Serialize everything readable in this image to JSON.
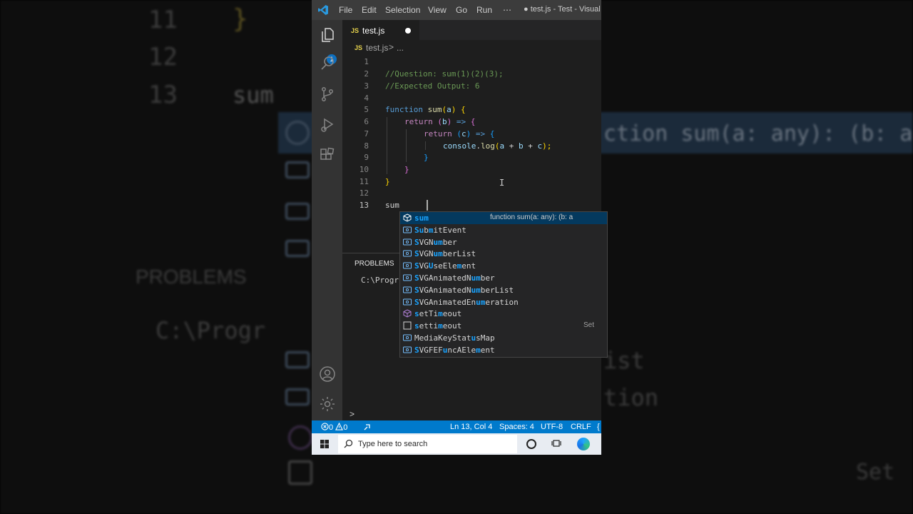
{
  "background_mirror": {
    "line_numbers": [
      "11",
      "12",
      "13"
    ],
    "brace": "}",
    "typed": "sum",
    "signature": "ction sum(a: any): (b: a",
    "panel_label": "PROBLEMS",
    "terminal": "C:\\Progr",
    "fragment_1": "ist",
    "fragment_2": "tion",
    "fragment_3": "Set"
  },
  "titlebar": {
    "menu": [
      "File",
      "Edit",
      "Selection",
      "View",
      "Go",
      "Run",
      "⋯"
    ],
    "window_title": "● test.js - Test - Visual S"
  },
  "activity_bar": {
    "explorer_badge": "1",
    "icons": [
      "files-icon",
      "search-icon",
      "source-control-icon",
      "run-debug-icon",
      "extensions-icon",
      "account-icon",
      "settings-gear-icon"
    ]
  },
  "tab": {
    "icon": "JS",
    "label": "test.js"
  },
  "breadcrumb": {
    "icon": "JS",
    "file": "test.js",
    "separator": ">",
    "ellipsis": "..."
  },
  "editor": {
    "line_numbers": [
      "1",
      "2",
      "3",
      "4",
      "5",
      "6",
      "7",
      "8",
      "9",
      "10",
      "11",
      "12",
      "13"
    ],
    "current_line": "13",
    "code": {
      "l2": "//Question: sum(1)(2)(3);",
      "l3": "//Expected Output: 6",
      "l5_kw": "function",
      "l5_name": "sum",
      "l5_open": "(",
      "l5_param": "a",
      "l5_close": ")",
      "l5_brace": "{",
      "l6_kw": "return",
      "l6_p": "(",
      "l6_param": "b",
      "l6_p2": ")",
      "l6_arrow": "=>",
      "l6_brace": "{",
      "l7_kw": "return",
      "l7_p": "(",
      "l7_param": "c",
      "l7_p2": ")",
      "l7_arrow": "=>",
      "l7_brace": "{",
      "l8_obj": "console",
      "l8_dot": ".",
      "l8_fn": "log",
      "l8_args_open": "(",
      "l8_a": "a",
      "l8_plus1": " + ",
      "l8_b": "b",
      "l8_plus2": " + ",
      "l8_c": "c",
      "l8_end": ");",
      "l9": "}",
      "l10": "}",
      "l11": "}",
      "l13": "sum"
    }
  },
  "suggest": {
    "items": [
      {
        "pre": "",
        "match": "sum",
        "post": "",
        "kind": "function",
        "detail": "function sum(a: any): (b: a"
      },
      {
        "pre": "",
        "match": "Su",
        "post": "b",
        "match2": "m",
        "post2": "itEvent",
        "kind": "variable"
      },
      {
        "pre": "",
        "match": "S",
        "post": "VGN",
        "match2": "um",
        "post2": "ber",
        "kind": "variable"
      },
      {
        "pre": "",
        "match": "S",
        "post": "VGN",
        "match2": "um",
        "post2": "berList",
        "kind": "variable"
      },
      {
        "pre": "",
        "match": "S",
        "post": "VG",
        "match2": "U",
        "post2": "seEle",
        "match3": "m",
        "post3": "ent",
        "kind": "variable"
      },
      {
        "pre": "",
        "match": "S",
        "post": "VGAnimatedN",
        "match2": "um",
        "post2": "ber",
        "kind": "variable"
      },
      {
        "pre": "",
        "match": "S",
        "post": "VGAnimatedN",
        "match2": "um",
        "post2": "berList",
        "kind": "variable"
      },
      {
        "pre": "",
        "match": "S",
        "post": "VGAnimatedEn",
        "match2": "um",
        "post2": "eration",
        "kind": "variable"
      },
      {
        "pre": "",
        "match": "s",
        "post": "etTi",
        "match2": "m",
        "post2": "eout",
        "kind": "function"
      },
      {
        "pre": "",
        "match": "s",
        "post": "etti",
        "match2": "m",
        "post2": "eout",
        "kind": "text",
        "detail": "Set"
      },
      {
        "pre": "Media",
        "match": "",
        "post": "KeyStat",
        "match2": "u",
        "post2": "sMap",
        "kind": "variable"
      },
      {
        "pre": "",
        "match": "S",
        "post": "VGFEF",
        "match2": "u",
        "post2": "ncAEle",
        "match3": "m",
        "post3": "ent",
        "kind": "variable"
      }
    ]
  },
  "panel": {
    "tab": "PROBLEMS",
    "terminal_text": "C:\\Progr",
    "chevron": ">"
  },
  "statusbar": {
    "errors": "0",
    "warnings": "0",
    "position": "Ln 13, Col 4",
    "spaces": "Spaces: 4",
    "encoding": "UTF-8",
    "eol": "CRLF",
    "lang_partial": "{"
  },
  "taskbar": {
    "search_placeholder": "Type here to search"
  },
  "colors": {
    "accent": "#007acc",
    "selection": "#04395e",
    "match": "#18a3ff"
  }
}
